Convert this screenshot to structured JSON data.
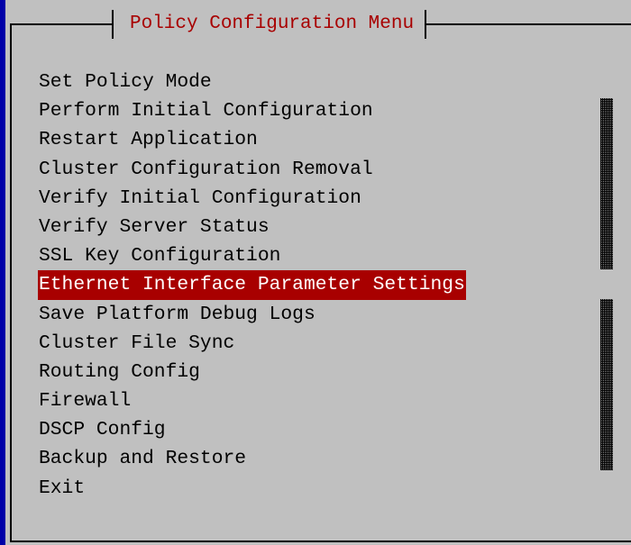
{
  "window": {
    "title": "Policy Configuration Menu"
  },
  "menu": {
    "items": [
      {
        "label": "Set Policy Mode",
        "selected": false
      },
      {
        "label": "Perform Initial Configuration",
        "selected": false
      },
      {
        "label": "Restart Application",
        "selected": false
      },
      {
        "label": "Cluster Configuration Removal",
        "selected": false
      },
      {
        "label": "Verify Initial Configuration",
        "selected": false
      },
      {
        "label": "Verify Server Status",
        "selected": false
      },
      {
        "label": "SSL Key Configuration",
        "selected": false
      },
      {
        "label": "Ethernet Interface Parameter Settings",
        "selected": true
      },
      {
        "label": "Save Platform Debug Logs",
        "selected": false
      },
      {
        "label": "Cluster File Sync",
        "selected": false
      },
      {
        "label": "Routing Config",
        "selected": false
      },
      {
        "label": "Firewall",
        "selected": false
      },
      {
        "label": "DSCP Config",
        "selected": false
      },
      {
        "label": "Backup and Restore",
        "selected": false
      },
      {
        "label": "Exit",
        "selected": false
      }
    ]
  },
  "colors": {
    "background": "#c0c0c0",
    "title_text": "#a80000",
    "selected_bg": "#a80000",
    "selected_text": "#ffffff",
    "terminal_bg": "#0000a8"
  }
}
